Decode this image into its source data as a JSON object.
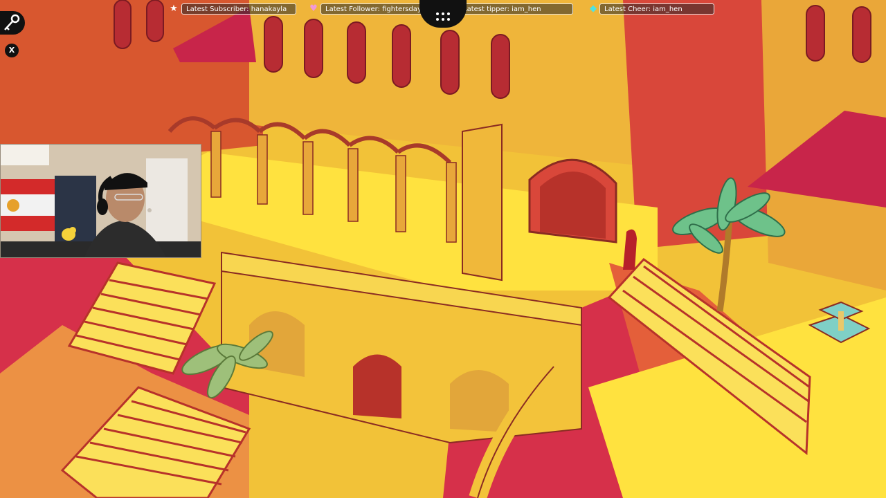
{
  "stream_overlay": {
    "latest_subscriber": "Latest Subscriber: hanakayla",
    "latest_follower": "Latest Follower: fightersdaygaming",
    "latest_tipper": "Latest tipper: iam_hen",
    "latest_cheer": "Latest Cheer: iam_hen"
  },
  "hud": {
    "close_label": "X"
  },
  "icons": {
    "subscriber": "star-icon",
    "follower": "heart-icon",
    "tipper": "coin-icon",
    "cheer": "diamond-icon",
    "key": "key-icon",
    "close": "close-icon"
  },
  "colors": {
    "wall_yellow": "#f3c33a",
    "ground_yellow": "#ffe23f",
    "shadow_red": "#d33a3a",
    "roof_crimson": "#c8254a",
    "palm_green": "#6ec28a"
  }
}
